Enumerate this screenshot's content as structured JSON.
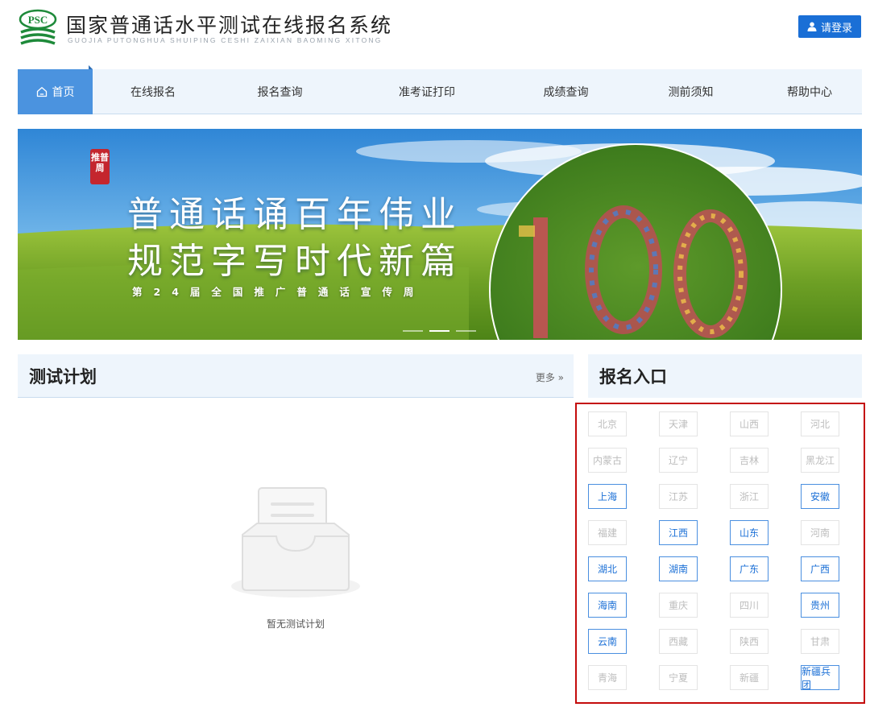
{
  "header": {
    "title": "国家普通话水平测试在线报名系统",
    "subtitle": "GUOJIA PUTONGHUA SHUIPING CESHI ZAIXIAN BAOMING XITONG",
    "logo_text": "PSC",
    "login_label": "请登录"
  },
  "nav": {
    "items": [
      "首页",
      "在线报名",
      "报名查询",
      "准考证打印",
      "成绩查询",
      "测前须知",
      "帮助中心"
    ]
  },
  "banner": {
    "seal_text": "推普周",
    "line1": "普通话诵百年伟业",
    "line2": "规范字写时代新篇",
    "line3": "第24届全国推广普通话宣传周",
    "slide_count": 3,
    "active_slide": 2
  },
  "plan": {
    "title": "测试计划",
    "more_label": "更多 »",
    "empty_text": "暂无测试计划"
  },
  "registration": {
    "title": "报名入口",
    "provinces": [
      {
        "name": "北京",
        "active": false
      },
      {
        "name": "天津",
        "active": false
      },
      {
        "name": "山西",
        "active": false
      },
      {
        "name": "河北",
        "active": false
      },
      {
        "name": "内蒙古",
        "active": false
      },
      {
        "name": "辽宁",
        "active": false
      },
      {
        "name": "吉林",
        "active": false
      },
      {
        "name": "黑龙江",
        "active": false
      },
      {
        "name": "上海",
        "active": true
      },
      {
        "name": "江苏",
        "active": false
      },
      {
        "name": "浙江",
        "active": false
      },
      {
        "name": "安徽",
        "active": true
      },
      {
        "name": "福建",
        "active": false
      },
      {
        "name": "江西",
        "active": true
      },
      {
        "name": "山东",
        "active": true
      },
      {
        "name": "河南",
        "active": false
      },
      {
        "name": "湖北",
        "active": true
      },
      {
        "name": "湖南",
        "active": true
      },
      {
        "name": "广东",
        "active": true
      },
      {
        "name": "广西",
        "active": true
      },
      {
        "name": "海南",
        "active": true
      },
      {
        "name": "重庆",
        "active": false
      },
      {
        "name": "四川",
        "active": false
      },
      {
        "name": "贵州",
        "active": true
      },
      {
        "name": "云南",
        "active": true
      },
      {
        "name": "西藏",
        "active": false
      },
      {
        "name": "陕西",
        "active": false
      },
      {
        "name": "甘肃",
        "active": false
      },
      {
        "name": "青海",
        "active": false
      },
      {
        "name": "宁夏",
        "active": false
      },
      {
        "name": "新疆",
        "active": false
      },
      {
        "name": "新疆兵团",
        "active": true
      }
    ]
  },
  "colors": {
    "brand_blue": "#1a6fd6",
    "nav_active": "#4b93df",
    "highlight_border": "#c40c0c",
    "logo_green": "#1e8a3a"
  }
}
